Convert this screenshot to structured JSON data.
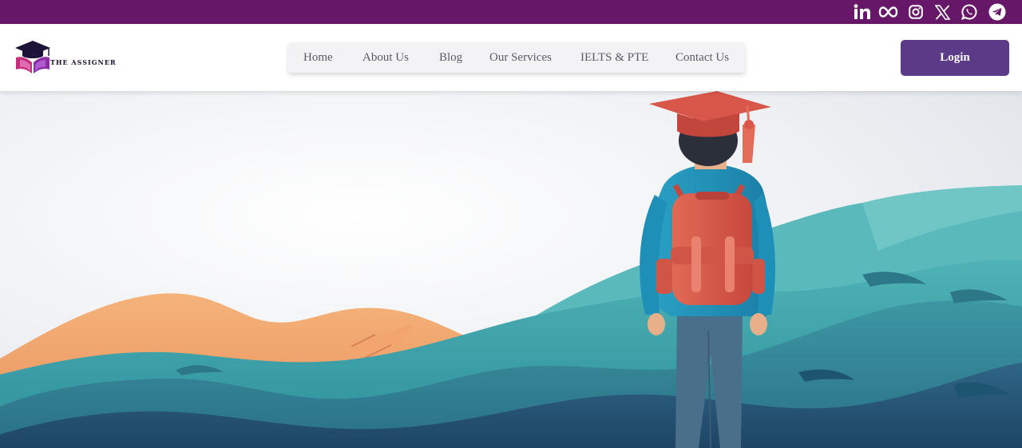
{
  "brand": {
    "name": "THE ASSIGNER"
  },
  "social": [
    {
      "icon": "linkedin-icon"
    },
    {
      "icon": "meta-icon"
    },
    {
      "icon": "instagram-icon"
    },
    {
      "icon": "x-twitter-icon"
    },
    {
      "icon": "whatsapp-icon"
    },
    {
      "icon": "telegram-icon"
    }
  ],
  "nav": {
    "items": [
      {
        "label": "Home"
      },
      {
        "label": "About Us"
      },
      {
        "label": "Blog"
      },
      {
        "label": "Our Services"
      },
      {
        "label": "IELTS & PTE"
      },
      {
        "label": "Contact Us"
      }
    ]
  },
  "header": {
    "login_label": "Login"
  },
  "colors": {
    "topbar": "#661767",
    "login_button": "#5b3a88",
    "hero_teal": "#3b9ea6",
    "hero_orange": "#f0a868",
    "cap_red": "#d9574a"
  },
  "hero": {
    "image": "student-with-graduation-cap-and-backpack-illustration"
  }
}
